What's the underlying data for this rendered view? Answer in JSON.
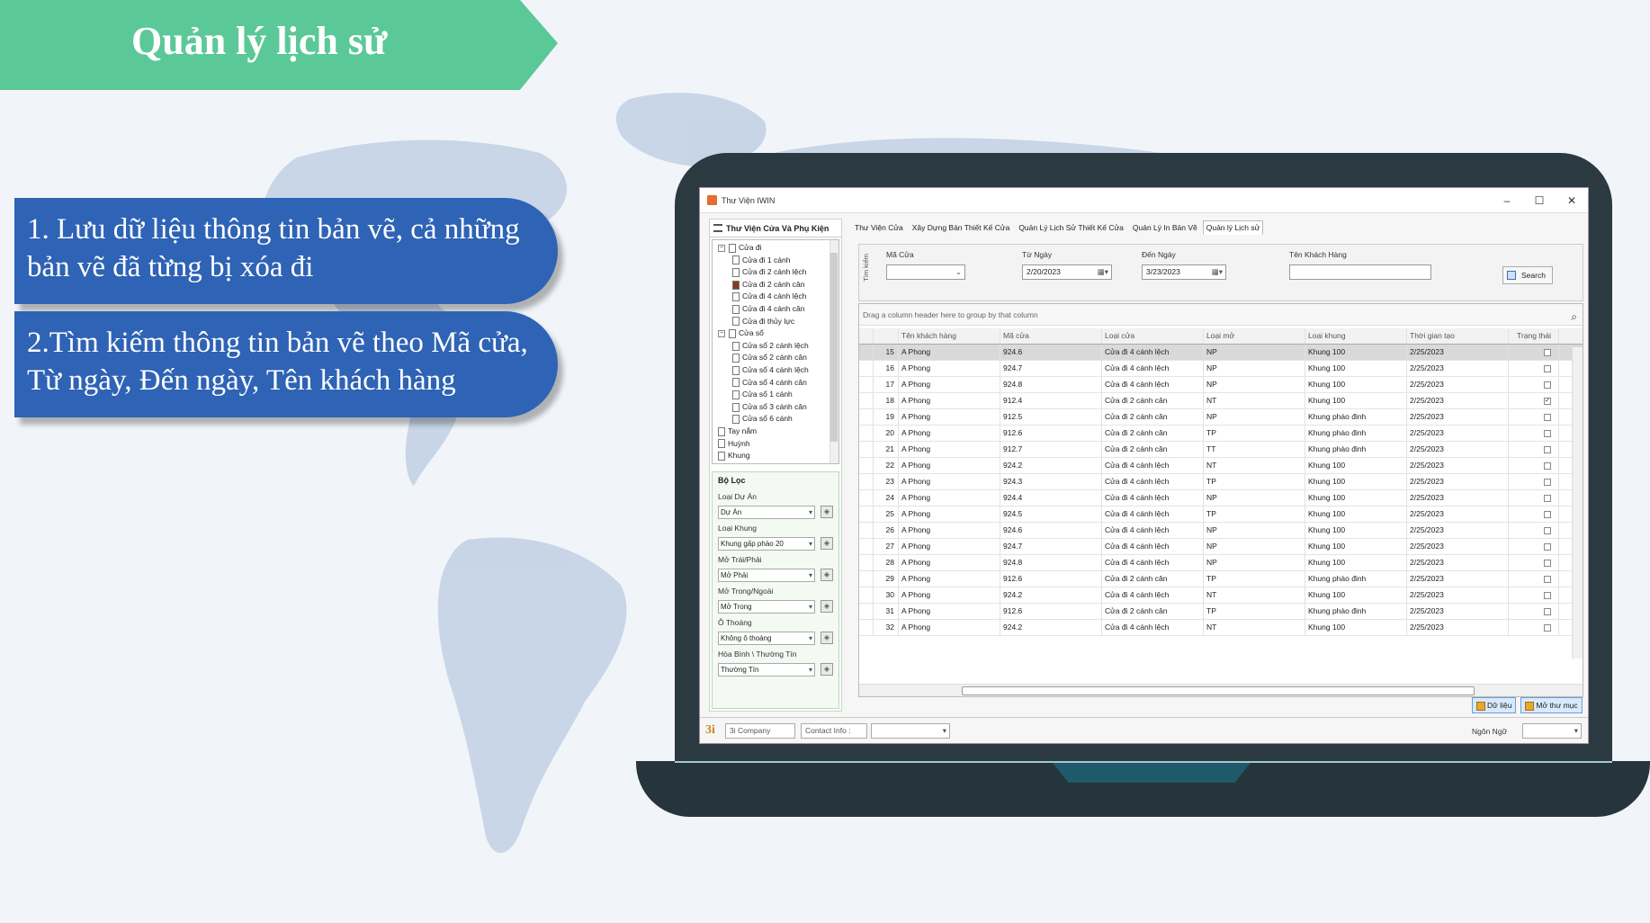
{
  "slide": {
    "title": "Quản lý lịch sử",
    "bullets": [
      "1. Lưu dữ liệu thông tin bản vẽ, cả những bản vẽ đã từng bị xóa đi",
      "2.Tìm kiếm thông tin bản vẽ theo Mã cửa, Từ ngày, Đến ngày, Tên khách hàng"
    ],
    "colors": {
      "banner": "#5bc898",
      "bubble": "#2e63b5"
    }
  },
  "window": {
    "title": "Thư Viện IWIN",
    "controls": [
      "–",
      "☐",
      "✕"
    ]
  },
  "left_pane": {
    "header": "Thư Viện Cửa Và Phụ Kiện",
    "tree": [
      {
        "label": "Cửa đi",
        "level": 0,
        "expander": "−"
      },
      {
        "label": "Cửa đi 1 cánh",
        "level": 1
      },
      {
        "label": "Cửa đi 2 cánh lệch",
        "level": 1
      },
      {
        "label": "Cửa đi 2 cánh cân",
        "level": 1,
        "selected": true
      },
      {
        "label": "Cửa đi 4 cánh lệch",
        "level": 1
      },
      {
        "label": "Cửa đi 4 cánh cân",
        "level": 1
      },
      {
        "label": "Cửa đi thủy lực",
        "level": 1
      },
      {
        "label": "Cửa sổ",
        "level": 0,
        "expander": "−"
      },
      {
        "label": "Cửa sổ 2 cánh lệch",
        "level": 1
      },
      {
        "label": "Cửa sổ 2 cánh cân",
        "level": 1
      },
      {
        "label": "Cửa sổ 4 cánh lệch",
        "level": 1
      },
      {
        "label": "Cửa sổ 4 cánh cân",
        "level": 1
      },
      {
        "label": "Cửa sổ 1 cánh",
        "level": 1
      },
      {
        "label": "Cửa sổ 3 cánh cân",
        "level": 1
      },
      {
        "label": "Cửa sổ 6 cánh",
        "level": 1
      },
      {
        "label": "Tay nắm",
        "level": 0
      },
      {
        "label": "Huỳnh",
        "level": 0
      },
      {
        "label": "Khung",
        "level": 0
      }
    ],
    "filter": {
      "title": "Bộ Lọc",
      "fields": [
        {
          "label": "Loại Dự Án",
          "value": "Dự Án"
        },
        {
          "label": "Loại Khung",
          "value": "Khung gấp phào 20"
        },
        {
          "label": "Mở Trái/Phải",
          "value": "Mở Phải"
        },
        {
          "label": "Mở Trong/Ngoài",
          "value": "Mở Trong"
        },
        {
          "label": "Ô Thoáng",
          "value": "Không ô thoáng"
        },
        {
          "label": "Hòa Bình \\ Thường Tín",
          "value": "Thường Tín"
        }
      ]
    }
  },
  "tabs": [
    {
      "label": "Thư Viện Cửa",
      "active": false
    },
    {
      "label": "Xây Dựng Bản Thiết Kế Cửa",
      "active": false
    },
    {
      "label": "Quản Lý Lịch Sử Thiết Kế Cửa",
      "active": false
    },
    {
      "label": "Quản Lý In Bản Vẽ",
      "active": false
    },
    {
      "label": "Quản lý Lịch sử",
      "active": true
    }
  ],
  "search": {
    "vertical_label": "Tìm kiếm",
    "ma_cua_label": "Mã Cửa",
    "ma_cua_value": "",
    "tu_ngay_label": "Từ Ngày",
    "tu_ngay_value": "2/20/2023",
    "den_ngay_label": "Đến Ngày",
    "den_ngay_value": "3/23/2023",
    "ten_kh_label": "Tên Khách Hàng",
    "ten_kh_value": "",
    "button": "Search"
  },
  "grid": {
    "group_hint": "Drag a column header here to group by that column",
    "columns": [
      "Tên khách hàng",
      "Mã cửa",
      "Loại cửa",
      "Loại mở",
      "Loại khung",
      "Thời gian tạo",
      "Trạng thái"
    ],
    "rows": [
      {
        "no": "15",
        "kh": "A Phong",
        "ma": "924.6",
        "loai": "Cửa đi 4 cánh lệch",
        "mo": "NP",
        "khung": "Khung 100",
        "tg": "2/25/2023",
        "tt": false
      },
      {
        "no": "16",
        "kh": "A Phong",
        "ma": "924.7",
        "loai": "Cửa đi 4 cánh lệch",
        "mo": "NP",
        "khung": "Khung 100",
        "tg": "2/25/2023",
        "tt": false
      },
      {
        "no": "17",
        "kh": "A Phong",
        "ma": "924.8",
        "loai": "Cửa đi 4 cánh lệch",
        "mo": "NP",
        "khung": "Khung 100",
        "tg": "2/25/2023",
        "tt": false
      },
      {
        "no": "18",
        "kh": "A Phong",
        "ma": "912.4",
        "loai": "Cửa đi 2 cánh cân",
        "mo": "NT",
        "khung": "Khung 100",
        "tg": "2/25/2023",
        "tt": true
      },
      {
        "no": "19",
        "kh": "A Phong",
        "ma": "912.5",
        "loai": "Cửa đi 2 cánh cân",
        "mo": "NP",
        "khung": "Khung phào đinh",
        "tg": "2/25/2023",
        "tt": false
      },
      {
        "no": "20",
        "kh": "A Phong",
        "ma": "912.6",
        "loai": "Cửa đi 2 cánh cân",
        "mo": "TP",
        "khung": "Khung phào đinh",
        "tg": "2/25/2023",
        "tt": false
      },
      {
        "no": "21",
        "kh": "A Phong",
        "ma": "912.7",
        "loai": "Cửa đi 2 cánh cân",
        "mo": "TT",
        "khung": "Khung phào đinh",
        "tg": "2/25/2023",
        "tt": false
      },
      {
        "no": "22",
        "kh": "A Phong",
        "ma": "924.2",
        "loai": "Cửa đi 4 cánh lệch",
        "mo": "NT",
        "khung": "Khung 100",
        "tg": "2/25/2023",
        "tt": false
      },
      {
        "no": "23",
        "kh": "A Phong",
        "ma": "924.3",
        "loai": "Cửa đi 4 cánh lệch",
        "mo": "TP",
        "khung": "Khung 100",
        "tg": "2/25/2023",
        "tt": false
      },
      {
        "no": "24",
        "kh": "A Phong",
        "ma": "924.4",
        "loai": "Cửa đi 4 cánh lệch",
        "mo": "NP",
        "khung": "Khung 100",
        "tg": "2/25/2023",
        "tt": false
      },
      {
        "no": "25",
        "kh": "A Phong",
        "ma": "924.5",
        "loai": "Cửa đi 4 cánh lệch",
        "mo": "TP",
        "khung": "Khung 100",
        "tg": "2/25/2023",
        "tt": false
      },
      {
        "no": "26",
        "kh": "A Phong",
        "ma": "924.6",
        "loai": "Cửa đi 4 cánh lệch",
        "mo": "NP",
        "khung": "Khung 100",
        "tg": "2/25/2023",
        "tt": false
      },
      {
        "no": "27",
        "kh": "A Phong",
        "ma": "924.7",
        "loai": "Cửa đi 4 cánh lệch",
        "mo": "NP",
        "khung": "Khung 100",
        "tg": "2/25/2023",
        "tt": false
      },
      {
        "no": "28",
        "kh": "A Phong",
        "ma": "924.8",
        "loai": "Cửa đi 4 cánh lệch",
        "mo": "NP",
        "khung": "Khung 100",
        "tg": "2/25/2023",
        "tt": false
      },
      {
        "no": "29",
        "kh": "A Phong",
        "ma": "912.6",
        "loai": "Cửa đi 2 cánh cân",
        "mo": "TP",
        "khung": "Khung phào đinh",
        "tg": "2/25/2023",
        "tt": false
      },
      {
        "no": "30",
        "kh": "A Phong",
        "ma": "924.2",
        "loai": "Cửa đi 4 cánh lệch",
        "mo": "NT",
        "khung": "Khung 100",
        "tg": "2/25/2023",
        "tt": false
      },
      {
        "no": "31",
        "kh": "A Phong",
        "ma": "912.6",
        "loai": "Cửa đi 2 cánh cân",
        "mo": "TP",
        "khung": "Khung phào đinh",
        "tg": "2/25/2023",
        "tt": false
      },
      {
        "no": "32",
        "kh": "A Phong",
        "ma": "924.2",
        "loai": "Cửa đi 4 cánh lệch",
        "mo": "NT",
        "khung": "Khung 100",
        "tg": "2/25/2023",
        "tt": false
      }
    ]
  },
  "bottom_buttons": [
    "Dữ liệu",
    "Mở thư mục"
  ],
  "statusbar": {
    "logo": "3i",
    "company": "3i Company",
    "contact": "Contact Info :",
    "language_label": "Ngôn Ngữ"
  }
}
